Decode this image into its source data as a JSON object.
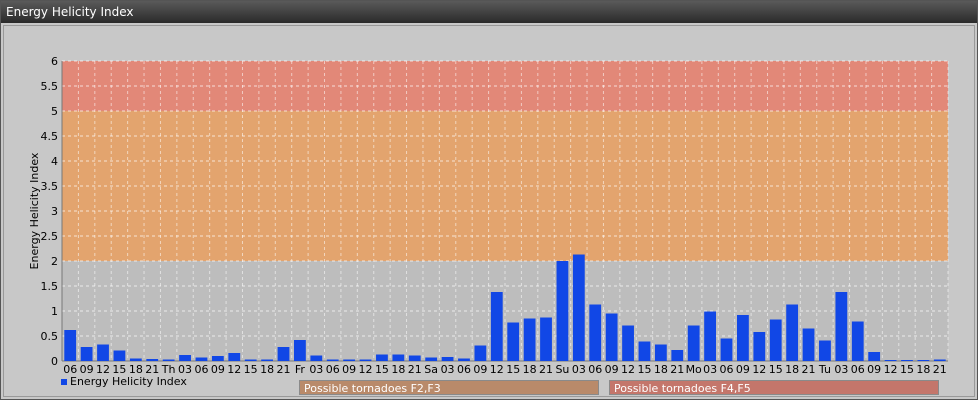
{
  "window": {
    "title": "Energy Helicity Index"
  },
  "chart_data": {
    "type": "bar",
    "title": "",
    "ylabel": "Energy Helicity Index",
    "xlabel": "",
    "ylim": [
      0,
      6
    ],
    "yticks": [
      "0",
      "0.5",
      "1",
      "1.5",
      "2",
      "2.5",
      "3",
      "3.5",
      "4",
      "4.5",
      "5",
      "5.5",
      "6"
    ],
    "categories": [
      "06",
      "09",
      "12",
      "15",
      "18",
      "21",
      "Th",
      "03",
      "06",
      "09",
      "12",
      "15",
      "18",
      "21",
      "Fr",
      "03",
      "06",
      "09",
      "12",
      "15",
      "18",
      "21",
      "Sa",
      "03",
      "06",
      "09",
      "12",
      "15",
      "18",
      "21",
      "Su",
      "03",
      "06",
      "09",
      "12",
      "15",
      "18",
      "21",
      "Mo",
      "03",
      "06",
      "09",
      "12",
      "15",
      "18",
      "21",
      "Tu",
      "03",
      "06",
      "09",
      "12",
      "15",
      "18",
      "21"
    ],
    "series": [
      {
        "name": "Energy Helicity Index",
        "values": [
          0.62,
          0.28,
          0.33,
          0.21,
          0.05,
          0.04,
          0.03,
          0.12,
          0.07,
          0.1,
          0.16,
          0.03,
          0.03,
          0.28,
          0.42,
          0.11,
          0.03,
          0.03,
          0.03,
          0.13,
          0.13,
          0.11,
          0.07,
          0.08,
          0.05,
          0.31,
          1.38,
          0.77,
          0.85,
          0.87,
          2.0,
          2.13,
          1.13,
          0.95,
          0.71,
          0.39,
          0.33,
          0.22,
          0.71,
          0.99,
          0.45,
          0.92,
          0.58,
          0.83,
          1.13,
          0.65,
          0.41,
          1.38,
          0.79,
          0.18,
          0.02,
          0.02,
          0.02,
          0.03
        ]
      }
    ],
    "bands": [
      {
        "from": 0,
        "to": 2,
        "color": "#bdbdbd"
      },
      {
        "from": 2,
        "to": 5,
        "color": "#e3a46e"
      },
      {
        "from": 5,
        "to": 6,
        "color": "#e28878"
      }
    ],
    "bar_color": "#1147e6",
    "grid": true,
    "legend_position": "bottom-left"
  },
  "legend_bars": [
    {
      "label": "Possible tornadoes F2,F3",
      "color": "#b98a6a"
    },
    {
      "label": "Possible tornadoes F4,F5",
      "color": "#c4766b"
    }
  ]
}
